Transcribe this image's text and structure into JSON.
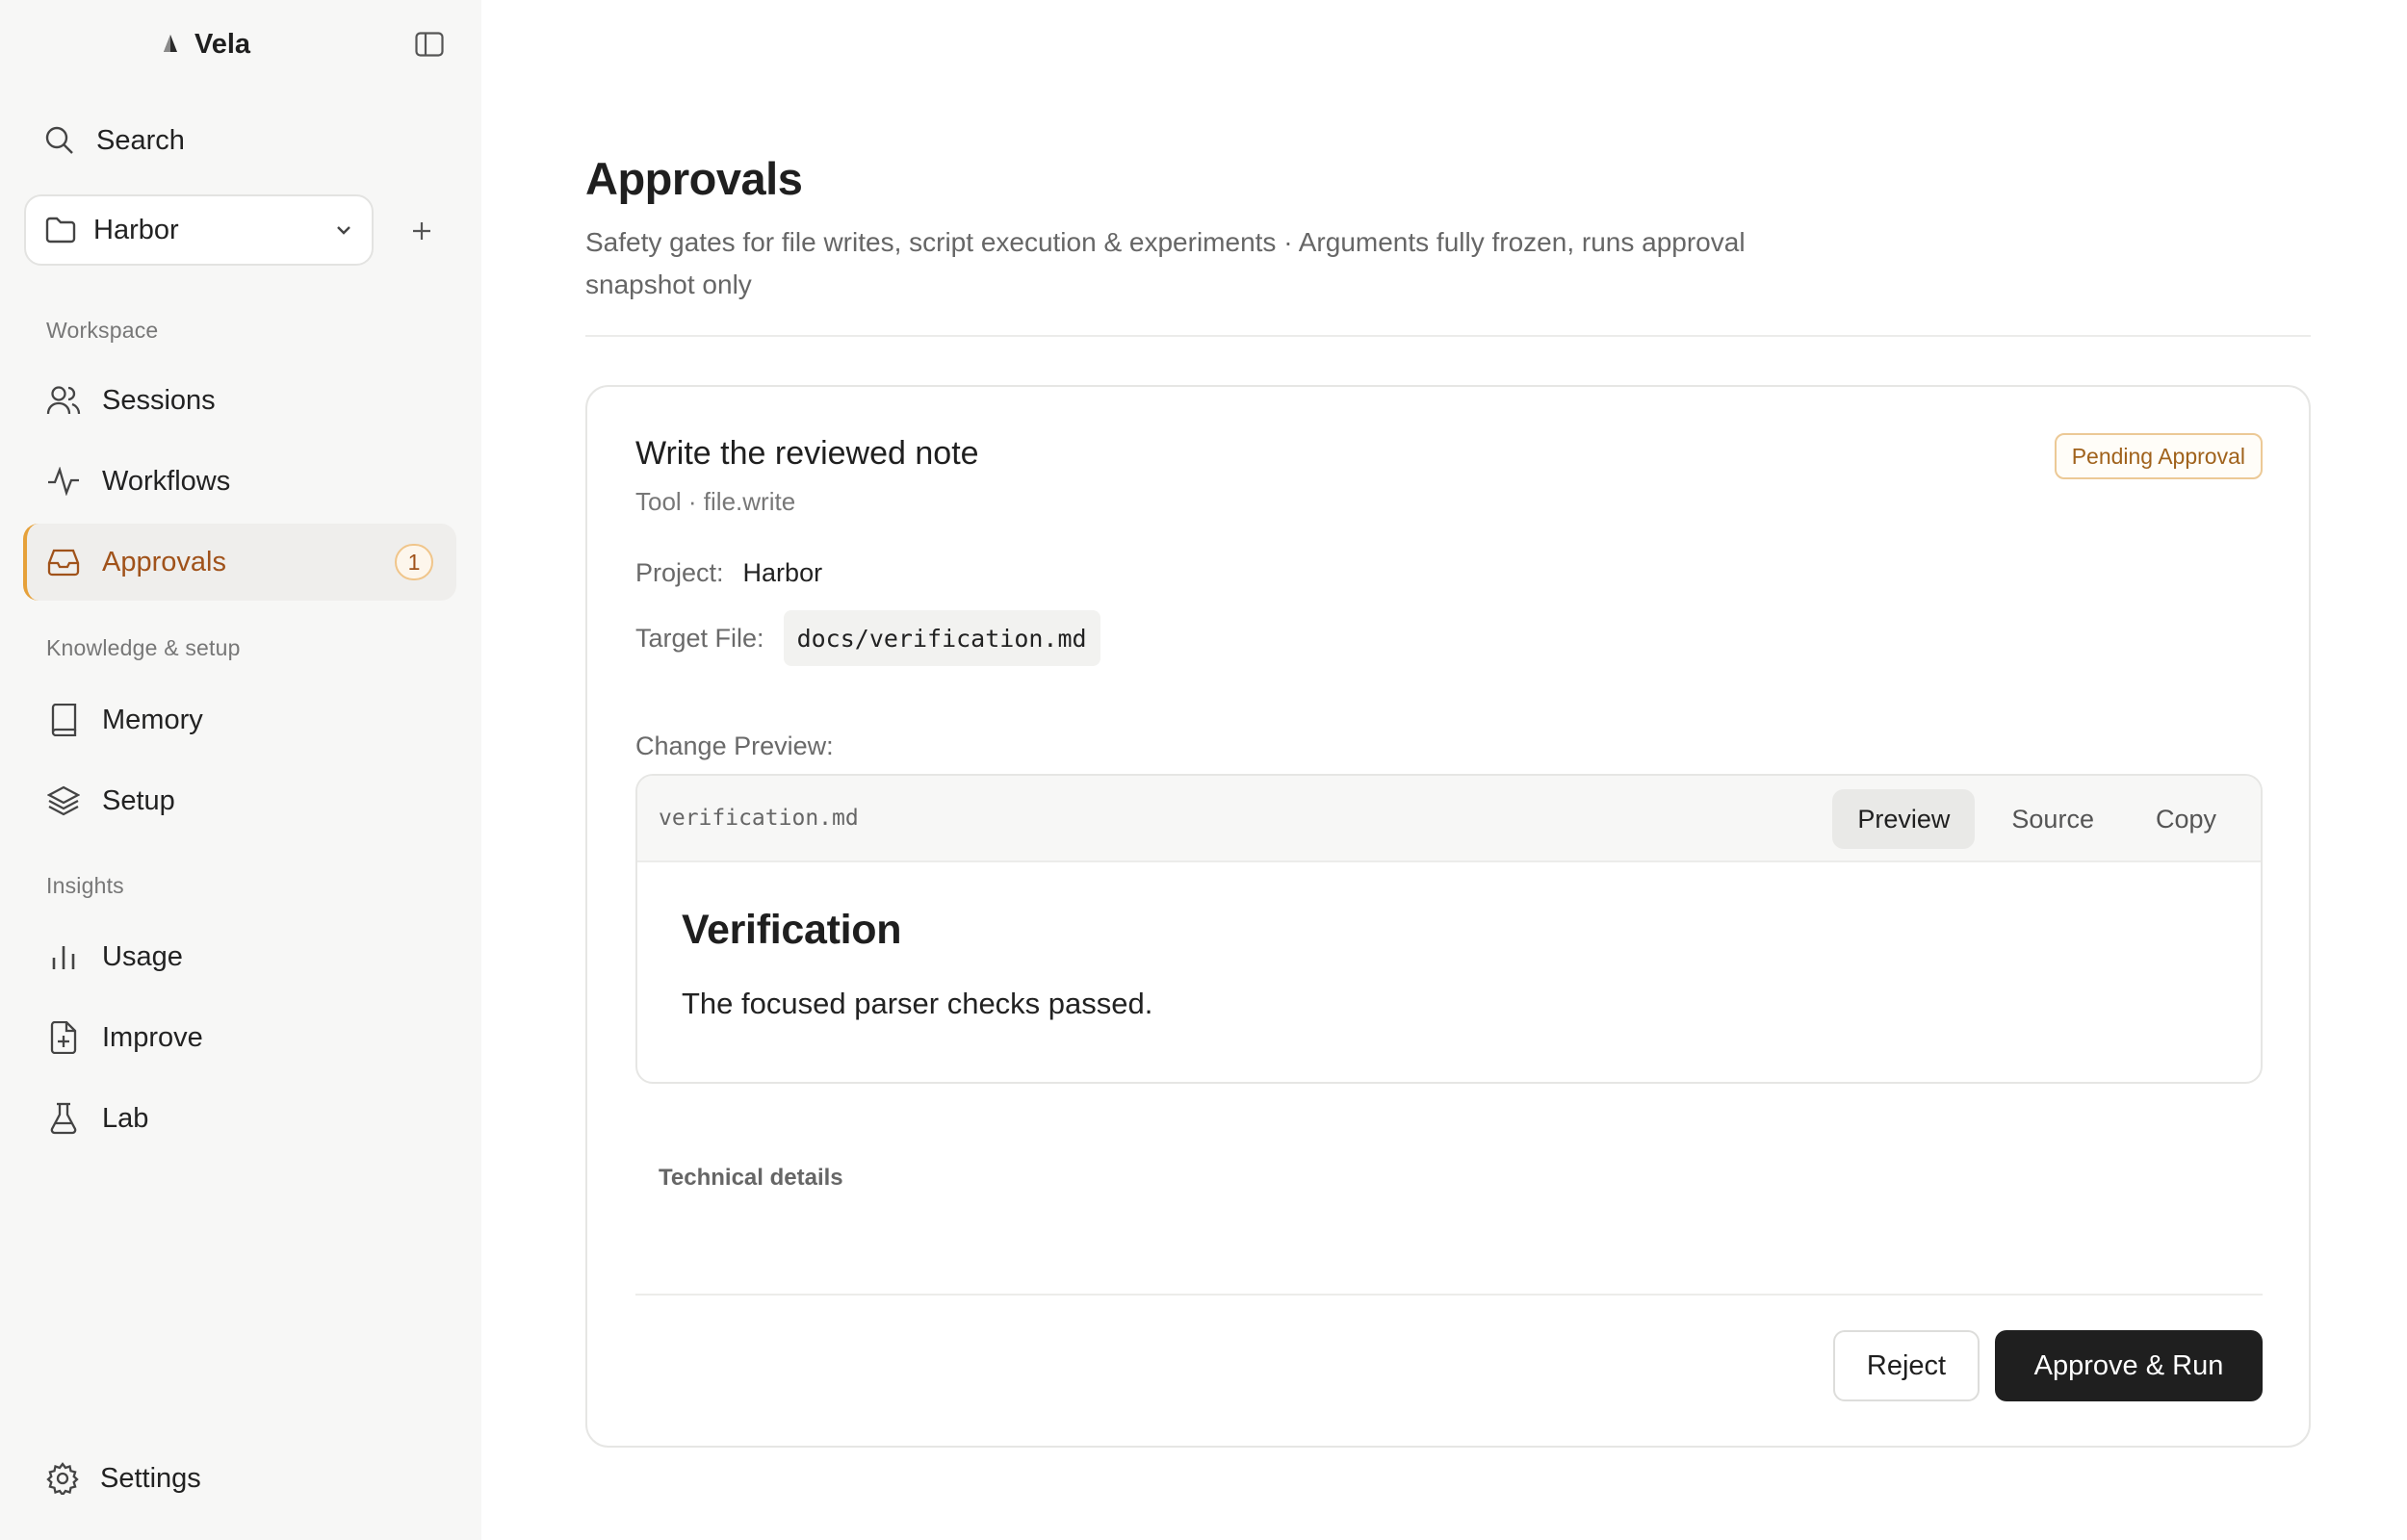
{
  "app": {
    "name": "Vela"
  },
  "sidebar": {
    "search_label": "Search",
    "project": {
      "selected": "Harbor"
    },
    "sections": {
      "workspace": "Workspace",
      "knowledge": "Knowledge & setup",
      "insights": "Insights"
    },
    "items": {
      "sessions": "Sessions",
      "workflows": "Workflows",
      "approvals": "Approvals",
      "approvals_count": "1",
      "memory": "Memory",
      "setup": "Setup",
      "usage": "Usage",
      "improve": "Improve",
      "lab": "Lab"
    },
    "settings_label": "Settings"
  },
  "page": {
    "title": "Approvals",
    "subtitle": "Safety gates for file writes, script execution & experiments · Arguments fully frozen, runs approval snapshot only"
  },
  "approval": {
    "title": "Write the reviewed note",
    "subtitle": "Tool · file.write",
    "status": "Pending Approval",
    "project_label": "Project:",
    "project_value": "Harbor",
    "target_label": "Target File:",
    "target_value": "docs/verification.md",
    "change_label": "Change Preview:",
    "preview": {
      "filename": "verification.md",
      "tabs": [
        "Preview",
        "Source",
        "Copy"
      ],
      "active_tab": "Preview",
      "heading": "Verification",
      "text": "The focused parser checks passed."
    },
    "technical_details": "Technical details",
    "reject_label": "Reject",
    "approve_label": "Approve & Run"
  },
  "colors": {
    "accent": "#e6a13a",
    "accent_text": "#a0521a",
    "primary_button": "#1f1f1f"
  }
}
